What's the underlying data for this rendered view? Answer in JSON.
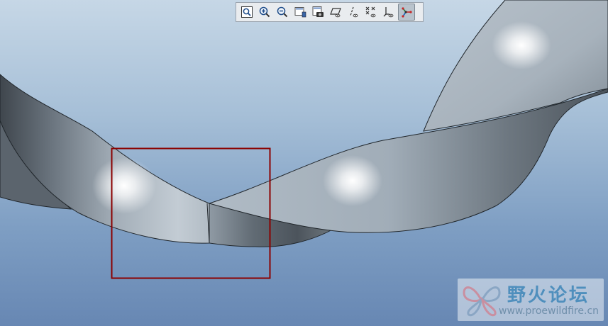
{
  "toolbar": {
    "buttons": [
      {
        "icon": "zoom-refit-icon",
        "active": false
      },
      {
        "icon": "zoom-in-icon",
        "active": false
      },
      {
        "icon": "zoom-out-icon",
        "active": false
      },
      {
        "icon": "repaint-icon",
        "active": false
      },
      {
        "icon": "saved-views-icon",
        "active": false
      },
      {
        "icon": "datum-planes-icon",
        "active": false
      },
      {
        "icon": "datum-axes-icon",
        "active": false
      },
      {
        "icon": "datum-points-icon",
        "active": false
      },
      {
        "icon": "coordinate-systems-icon",
        "active": false
      },
      {
        "icon": "spin-center-icon",
        "active": true
      }
    ]
  },
  "viewport": {
    "selection_box_color": "#8b0000",
    "surface_color": "#9aa6b1"
  },
  "watermark": {
    "title": "野火论坛",
    "url": "www.proewildfire.cn"
  }
}
